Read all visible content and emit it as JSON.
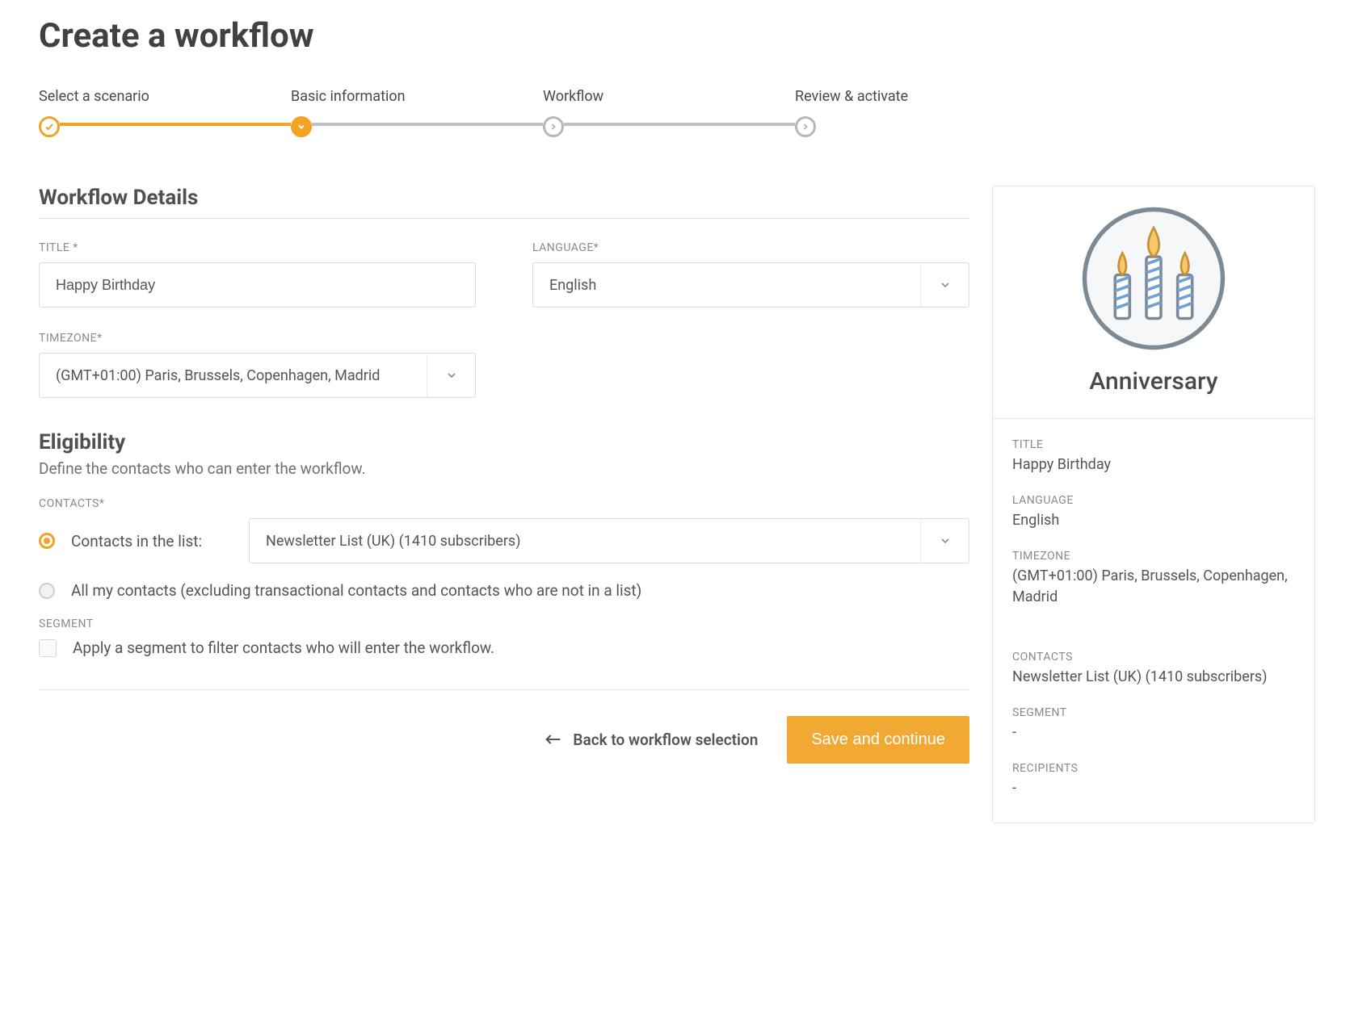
{
  "page_title": "Create a workflow",
  "wizard": [
    {
      "label": "Select a scenario",
      "state": "done"
    },
    {
      "label": "Basic information",
      "state": "active"
    },
    {
      "label": "Workflow",
      "state": "todo"
    },
    {
      "label": "Review & activate",
      "state": "todo"
    }
  ],
  "details": {
    "heading": "Workflow Details",
    "title_label": "TITLE *",
    "title_value": "Happy Birthday",
    "language_label": "LANGUAGE*",
    "language_value": "English",
    "timezone_label": "TIMEZONE*",
    "timezone_value": "(GMT+01:00) Paris, Brussels, Copenhagen, Madrid"
  },
  "eligibility": {
    "heading": "Eligibility",
    "sub": "Define the contacts who can enter the workflow.",
    "contacts_label": "CONTACTS*",
    "option_list_label": "Contacts in the list:",
    "list_value": "Newsletter List (UK) (1410 subscribers)",
    "option_all_label": "All my contacts (excluding transactional contacts and contacts who are not in a list)",
    "segment_label": "SEGMENT",
    "segment_check_label": "Apply a segment to filter contacts who will enter the workflow."
  },
  "footer": {
    "back_label": "Back to workflow selection",
    "save_label": "Save and continue"
  },
  "summary": {
    "name": "Anniversary",
    "title_label": "TITLE",
    "title_value": "Happy Birthday",
    "language_label": "LANGUAGE",
    "language_value": "English",
    "timezone_label": "TIMEZONE",
    "timezone_value": "(GMT+01:00) Paris, Brussels, Copenhagen, Madrid",
    "contacts_label": "CONTACTS",
    "contacts_value": "Newsletter List (UK) (1410 subscribers)",
    "segment_label": "SEGMENT",
    "segment_value": "-",
    "recipients_label": "RECIPIENTS",
    "recipients_value": "-"
  }
}
